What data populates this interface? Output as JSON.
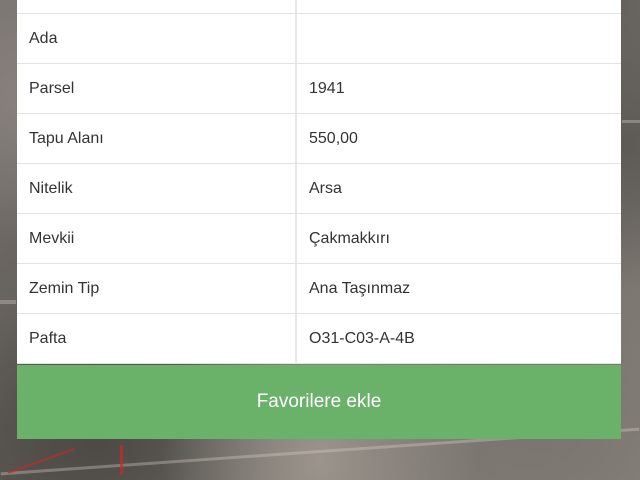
{
  "table": {
    "rows": [
      {
        "label": "",
        "value": ""
      },
      {
        "label": "Ada",
        "value": ""
      },
      {
        "label": "Parsel",
        "value": "1941"
      },
      {
        "label": "Tapu Alanı",
        "value": "550,00"
      },
      {
        "label": "Nitelik",
        "value": "Arsa"
      },
      {
        "label": "Mevkii",
        "value": "Çakmakkırı"
      },
      {
        "label": "Zemin Tip",
        "value": "Ana Taşınmaz"
      },
      {
        "label": "Pafta",
        "value": "O31-C03-A-4B"
      }
    ]
  },
  "actions": {
    "favorite_label": "Favorilere ekle"
  },
  "colors": {
    "button_green": "#6ab16a"
  }
}
